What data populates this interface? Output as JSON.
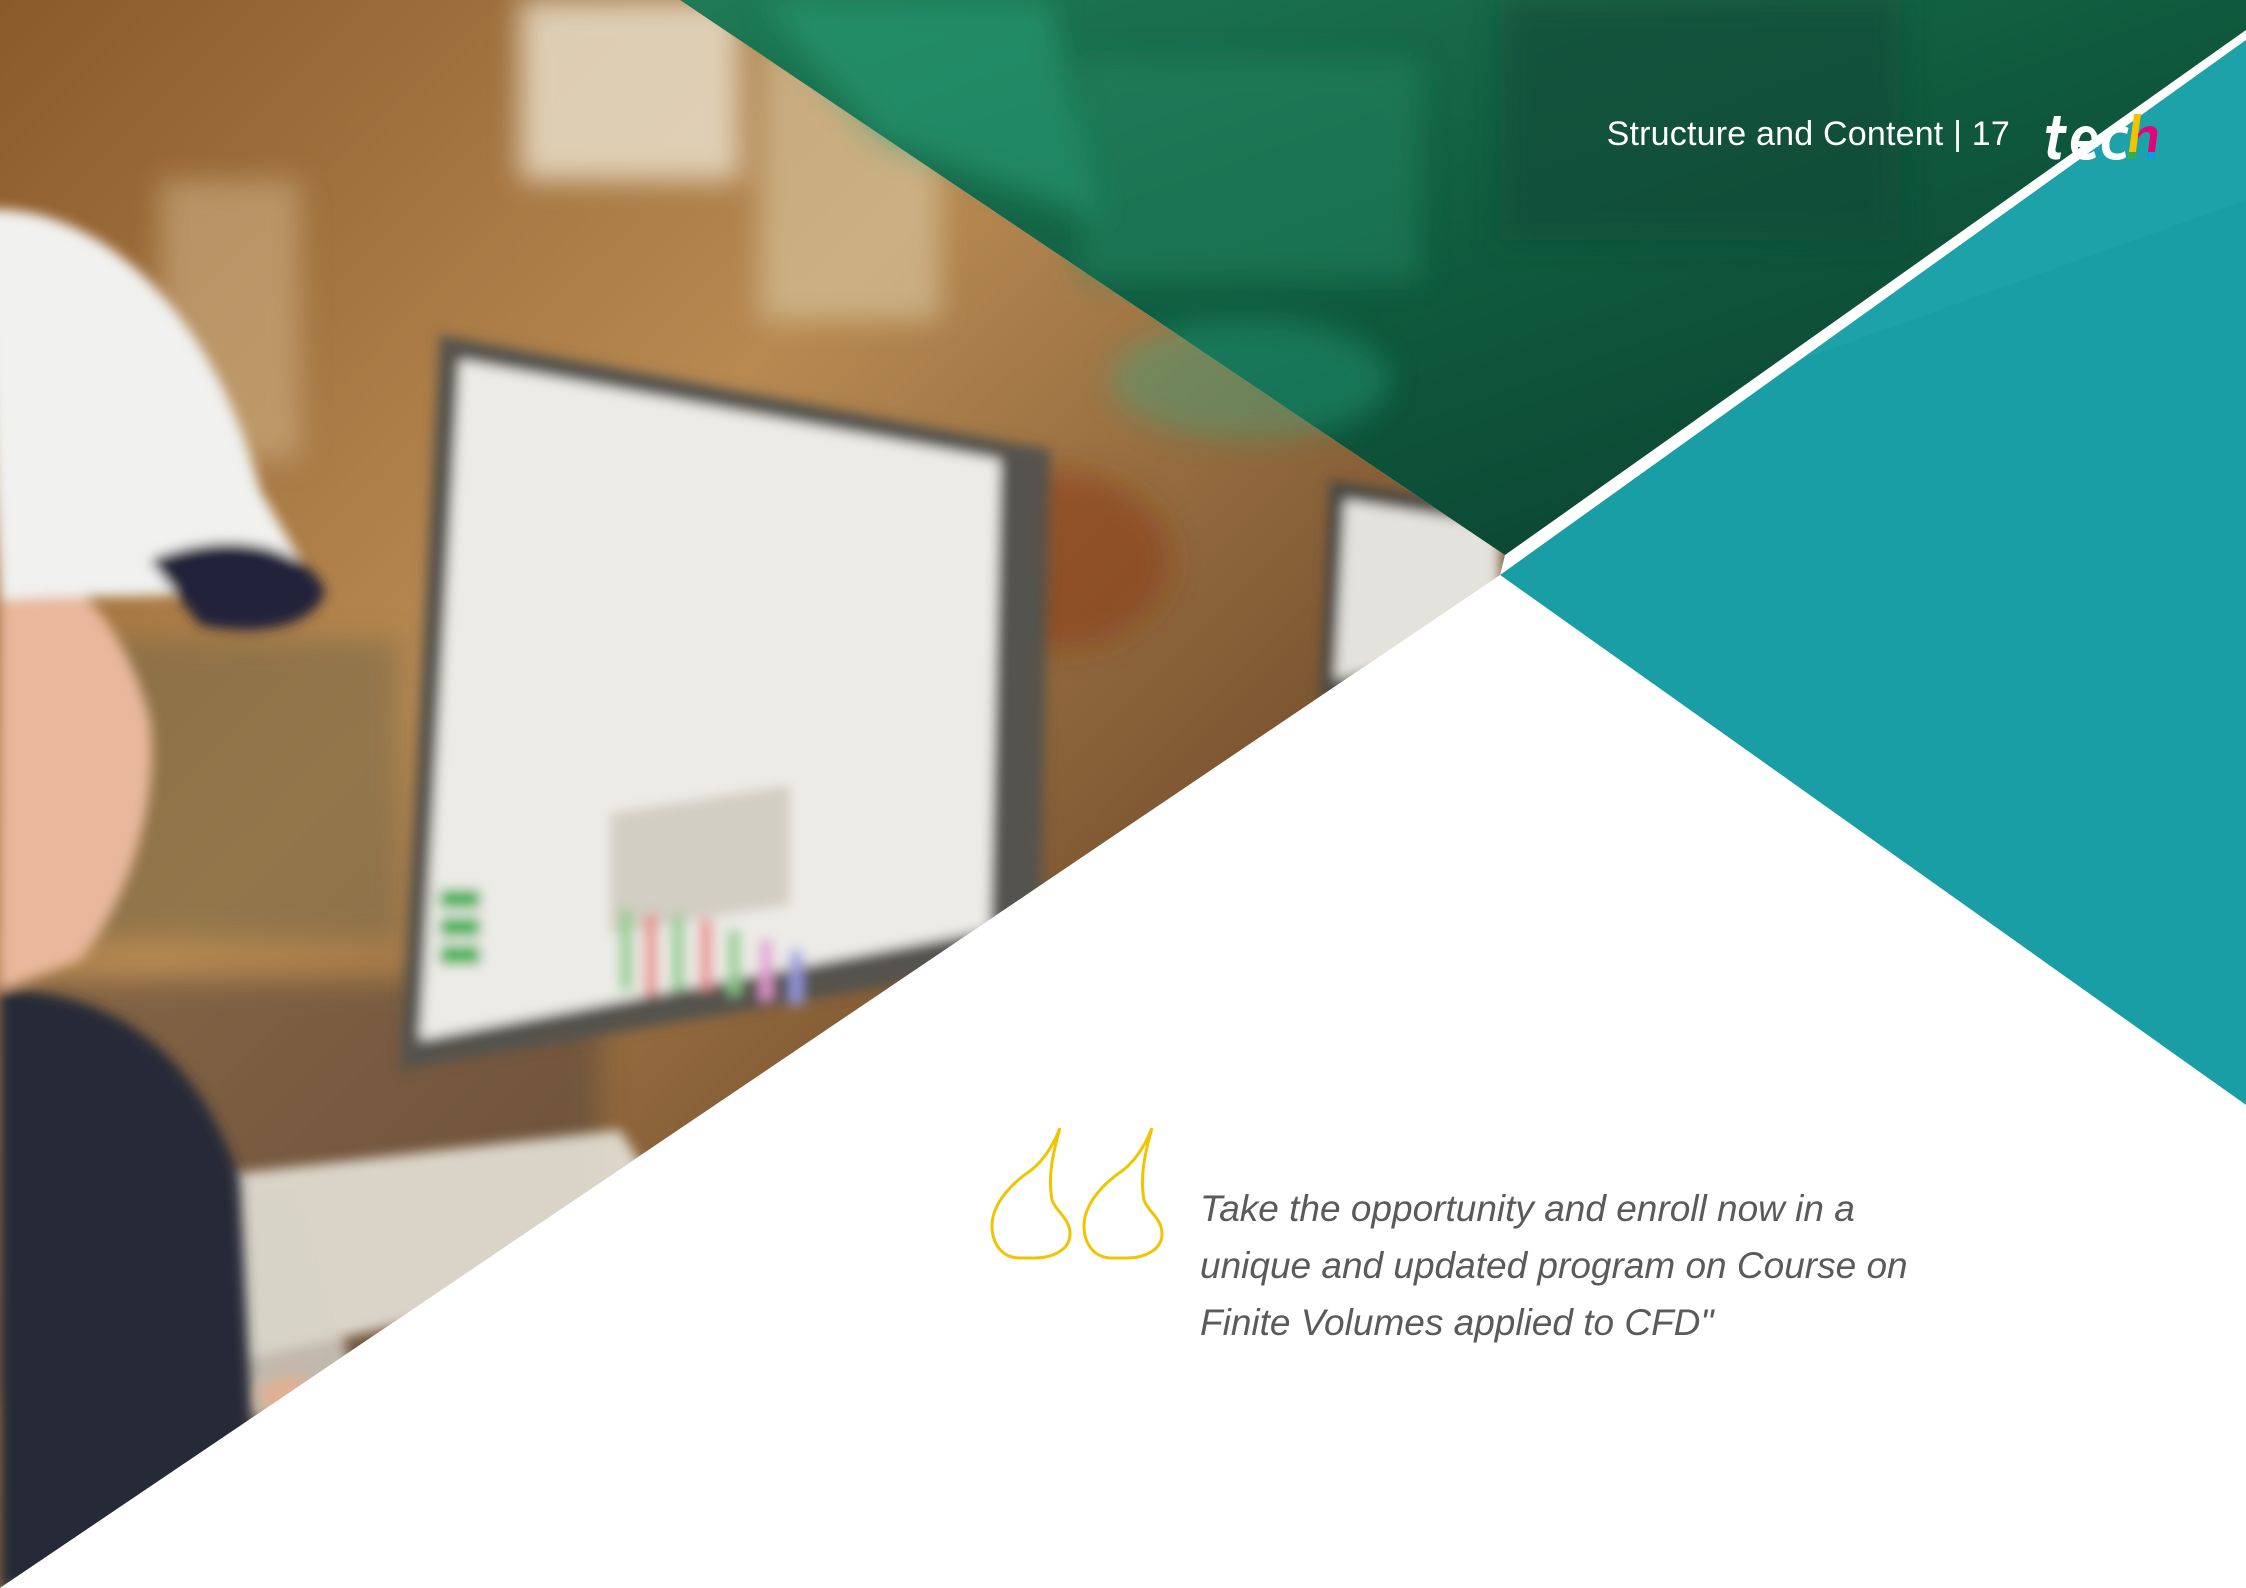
{
  "header": {
    "section_label": "Structure and Content | 17",
    "logo_text": "tech"
  },
  "quote": {
    "text": "Take the opportunity and enroll now in a unique and updated program on Course on Finite Volumes applied to CFD\""
  },
  "colors": {
    "teal": "#1a9ea5",
    "quote_mark": "#f2c400",
    "quote_text": "#5a5a5a"
  },
  "icons": {
    "quote_mark": "opening-quote-icon"
  }
}
